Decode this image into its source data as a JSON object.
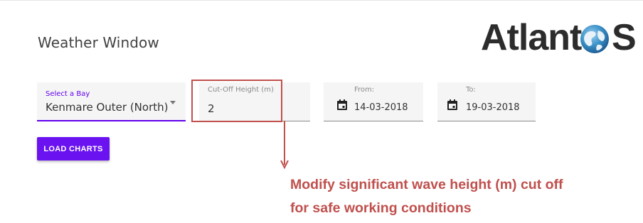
{
  "page": {
    "title": "Weather Window"
  },
  "logo": {
    "text": "Atlant",
    "text_end": "S",
    "icon": "globe-icon",
    "brand_color": "#2c2c2c",
    "accent_color": "#3a8fc6"
  },
  "form": {
    "bay": {
      "label": "Select a Bay",
      "value": "Kenmare Outer (North)",
      "icon": "chevron-down-icon"
    },
    "cutoff": {
      "label": "Cut-Off Height (m)",
      "value": "2"
    },
    "from": {
      "label": "From:",
      "value": "14-03-2018",
      "icon": "calendar-icon"
    },
    "to": {
      "label": "To:",
      "value": "19-03-2018",
      "icon": "calendar-icon"
    },
    "accent_color": "#6200ee"
  },
  "actions": {
    "load_charts_label": "LOAD CHARTS",
    "button_color": "#6a12f0"
  },
  "annotation": {
    "line1": "Modify significant wave height (m) cut off",
    "line2": "for safe working conditions",
    "color": "#c0504d"
  }
}
